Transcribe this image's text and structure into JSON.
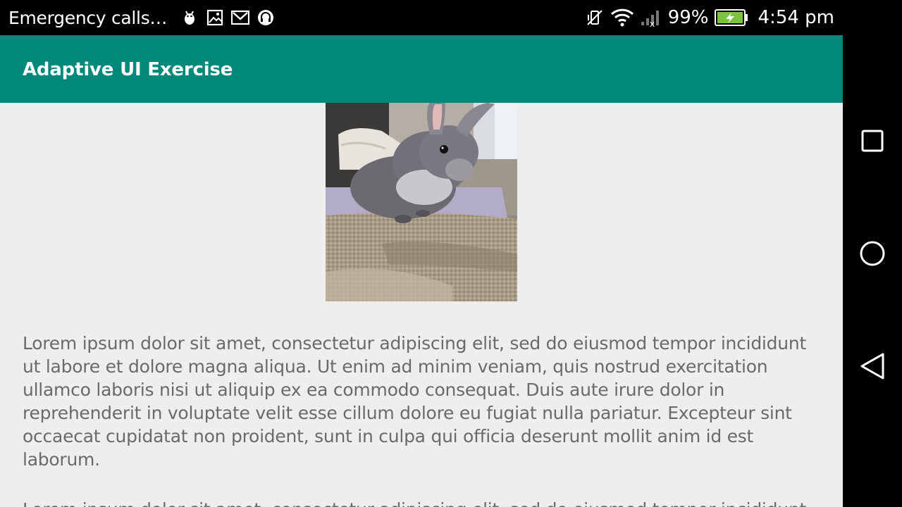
{
  "status_bar": {
    "carrier_text": "Emergency calls…",
    "notification_icons": [
      "android-debug-icon",
      "image-icon",
      "gmail-icon",
      "headset-support-icon"
    ],
    "battery_percent": "99%",
    "time": "4:54 pm",
    "battery_color": "#7cc43a"
  },
  "app_bar": {
    "title": "Adaptive UI Exercise",
    "color": "#00887a"
  },
  "content": {
    "image_subject": "grey rabbit on a burlap sofa",
    "paragraphs": [
      "Lorem ipsum dolor sit amet, consectetur adipiscing elit, sed do eiusmod tempor incididunt ut labore et dolore magna aliqua. Ut enim ad minim veniam, quis nostrud exercitation ullamco laboris nisi ut aliquip ex ea commodo consequat. Duis aute irure dolor in reprehenderit in voluptate velit esse cillum dolore eu fugiat nulla pariatur. Excepteur sint occaecat cupidatat non proident, sunt in culpa qui officia deserunt mollit anim id est laborum.",
      "Lorem ipsum dolor sit amet, consectetur adipiscing elit, sed do eiusmod tempor incididunt"
    ]
  },
  "nav_bar": {
    "buttons": [
      "recents-button",
      "home-button",
      "back-button"
    ]
  }
}
